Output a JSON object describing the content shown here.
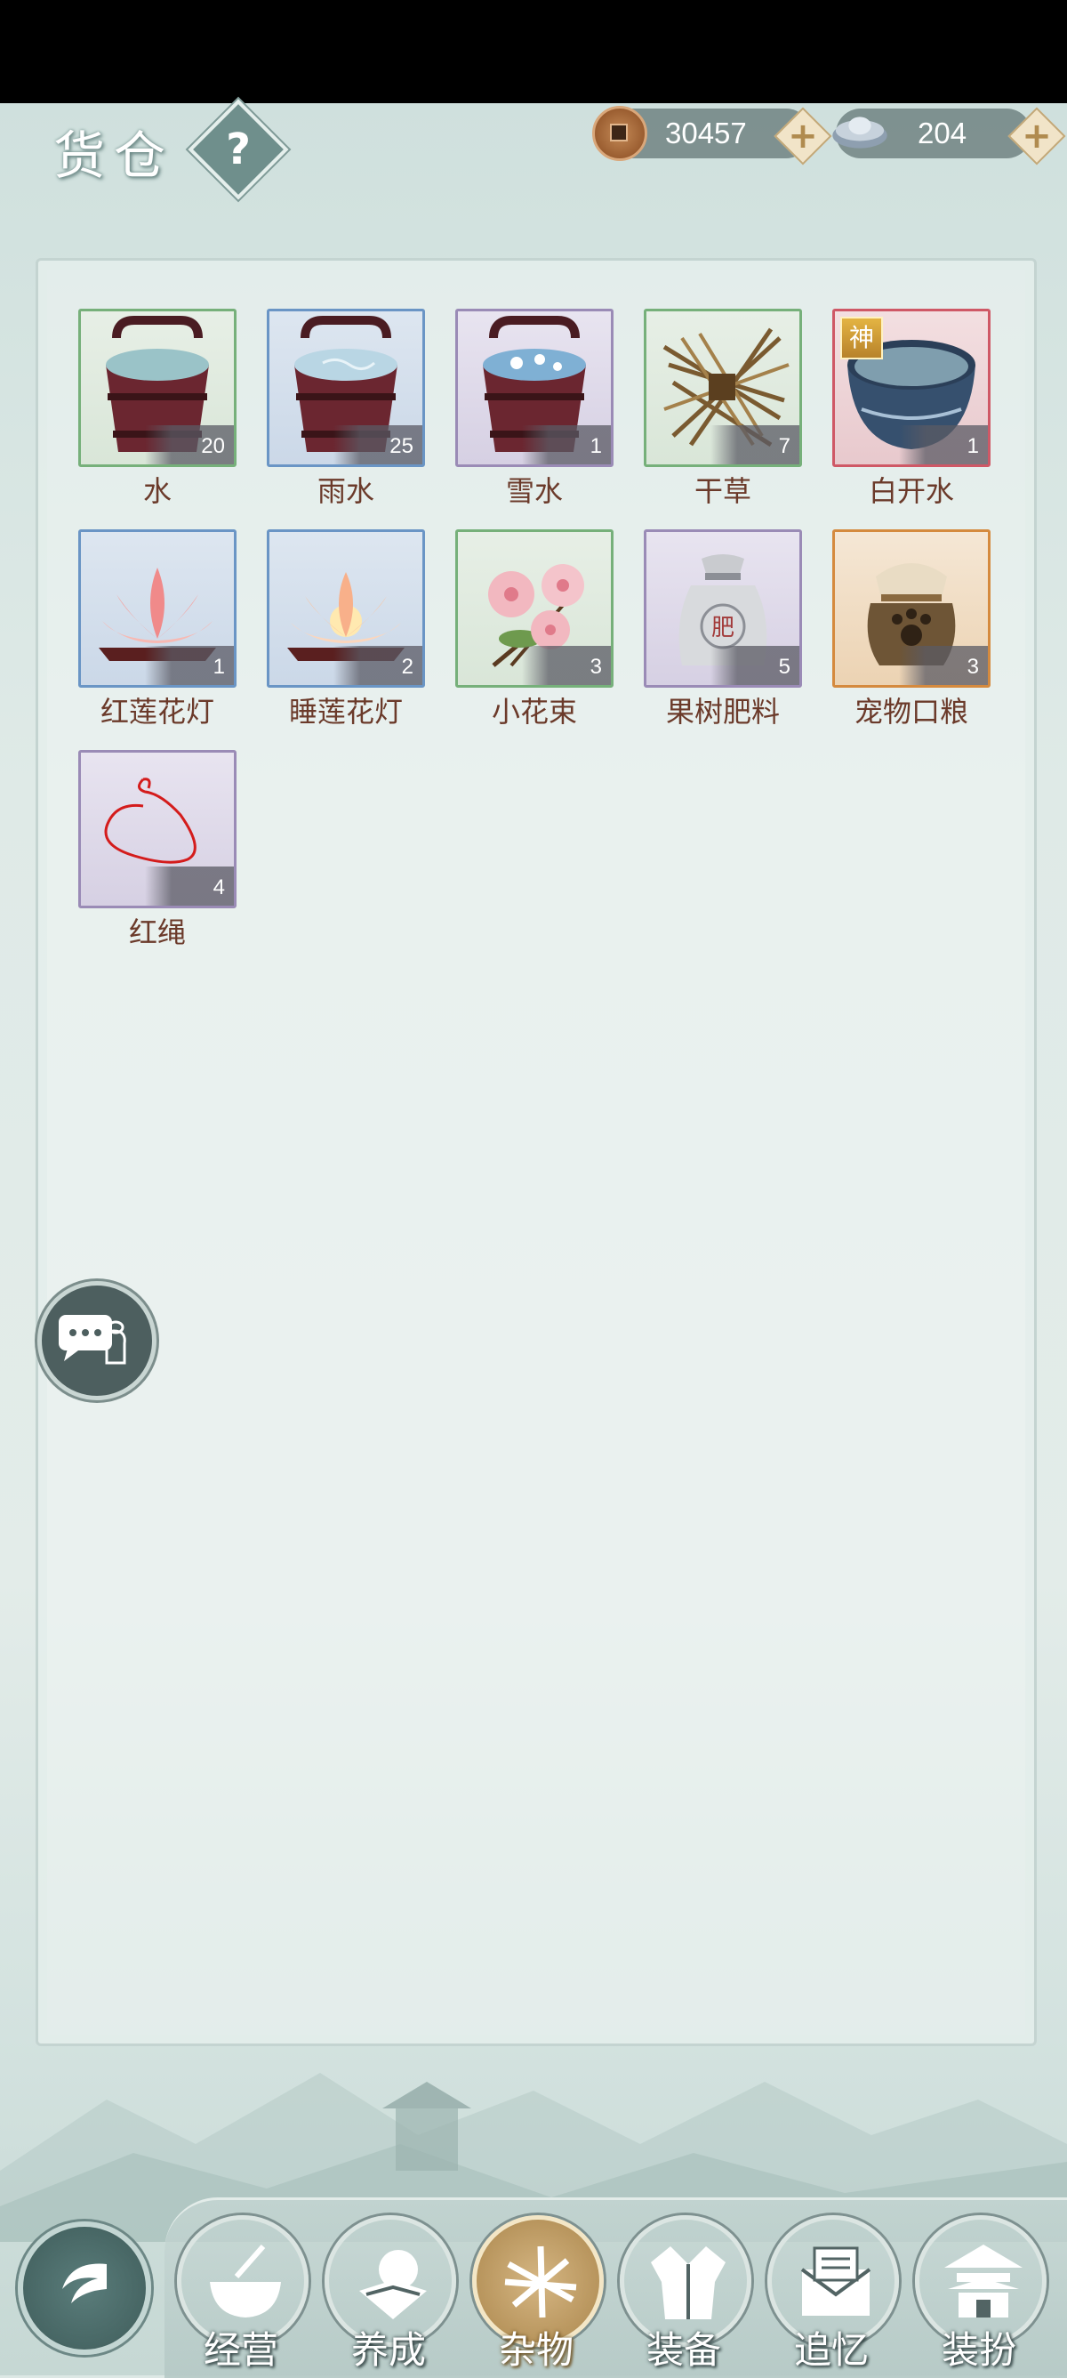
{
  "header": {
    "title": "货仓",
    "help_label": "?",
    "copper_coins": "30457",
    "silver_ingots": "204"
  },
  "items": [
    {
      "name": "水",
      "count": "20",
      "rarity": "green",
      "icon": "water-bucket-icon"
    },
    {
      "name": "雨水",
      "count": "25",
      "rarity": "blue",
      "icon": "rain-water-bucket-icon"
    },
    {
      "name": "雪水",
      "count": "1",
      "rarity": "purple",
      "icon": "snow-water-bucket-icon"
    },
    {
      "name": "干草",
      "count": "7",
      "rarity": "green",
      "icon": "hay-bundle-icon"
    },
    {
      "name": "白开水",
      "count": "1",
      "rarity": "red",
      "icon": "boiled-water-bowl-icon",
      "badge": "神"
    },
    {
      "name": "红莲花灯",
      "count": "1",
      "rarity": "blue",
      "icon": "red-lotus-lantern-icon"
    },
    {
      "name": "睡莲花灯",
      "count": "2",
      "rarity": "blue",
      "icon": "water-lily-lantern-icon"
    },
    {
      "name": "小花束",
      "count": "3",
      "rarity": "green",
      "icon": "flower-bouquet-icon"
    },
    {
      "name": "果树肥料",
      "count": "5",
      "rarity": "purple",
      "icon": "fertilizer-sack-icon",
      "sack_text": "肥"
    },
    {
      "name": "宠物口粮",
      "count": "3",
      "rarity": "orange",
      "icon": "pet-food-jar-icon"
    },
    {
      "name": "红绳",
      "count": "4",
      "rarity": "purple",
      "icon": "red-string-icon"
    }
  ],
  "nav": {
    "tabs": [
      {
        "label": "经营",
        "icon": "bowl-icon"
      },
      {
        "label": "养成",
        "icon": "crystal-ball-icon"
      },
      {
        "label": "杂物",
        "icon": "straw-bundle-icon",
        "active": true
      },
      {
        "label": "装备",
        "icon": "robe-icon"
      },
      {
        "label": "追忆",
        "icon": "letter-icon"
      },
      {
        "label": "装扮",
        "icon": "pavilion-icon"
      }
    ]
  },
  "colors": {
    "rarity_green": "#76b07a",
    "rarity_blue": "#6a95c5",
    "rarity_purple": "#9a8bb6",
    "rarity_red": "#cf5866",
    "rarity_orange": "#d58a3e",
    "label_text": "#6b3a2a",
    "active_tab": "#b8955d"
  }
}
